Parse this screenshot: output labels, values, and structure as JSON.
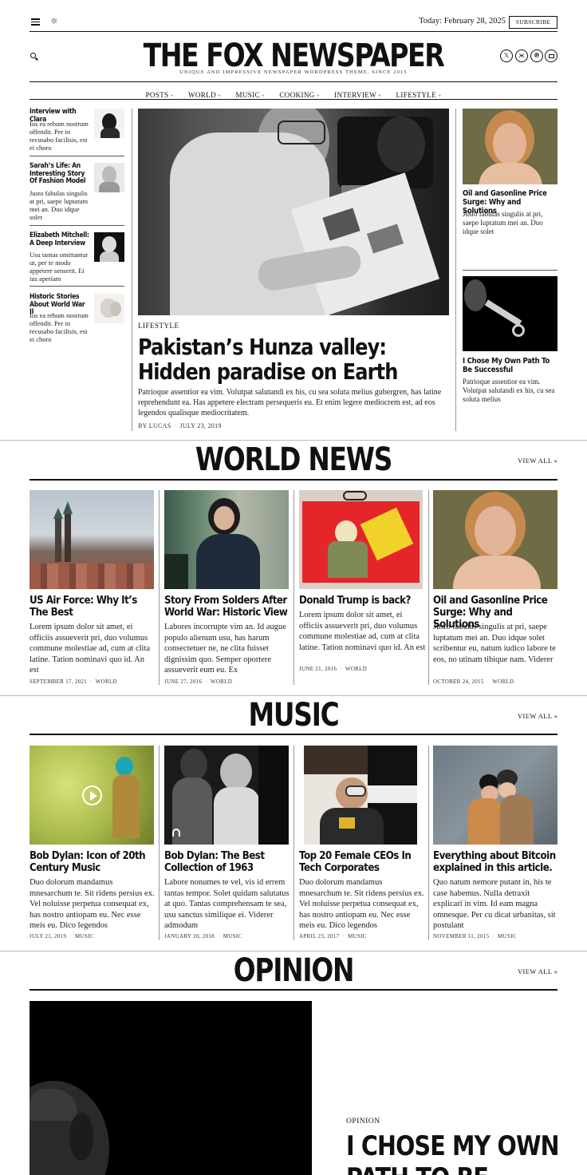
{
  "topbar": {
    "date": "Today: February 28, 2025",
    "subscribe": "SUBSCRIBE"
  },
  "masthead": {
    "title": "THE FOX NEWSPAPER",
    "tagline": "UNIQUE AND IMPRESSIVE NEWSPAPER WORDPRESS THEME. SINCE 2015"
  },
  "social_icons": [
    "x-icon",
    "bluesky-icon",
    "pinterest-icon",
    "mail-icon"
  ],
  "nav": [
    {
      "label": "POSTS"
    },
    {
      "label": "WORLD"
    },
    {
      "label": "MUSIC"
    },
    {
      "label": "COOKING"
    },
    {
      "label": "INTERVIEW"
    },
    {
      "label": "LIFESTYLE"
    }
  ],
  "sidebar_left": [
    {
      "title": "Interview with Clara",
      "excerpt": "Ius ea rebum nostrum offendit. Per in recusabo facilisis, est ei choro"
    },
    {
      "title": "Sarah’s Life: An Interesting Story Of Fashion Model",
      "excerpt": "Justo fabulas singulis at pri, saepe luptatum mei an. Duo idque solet"
    },
    {
      "title": "Elizabeth Mitchell: A Deep Interview",
      "excerpt": "Usu tantas omittantur ut, per te modo appetere senserit. Ei ius aperiam"
    },
    {
      "title": "Historic Stories About World War II",
      "excerpt": "Ius ea rebum nostrum offendit. Per in recusabo facilisis, est ei choro"
    }
  ],
  "hero": {
    "category": "LIFESTYLE",
    "title": "Pakistan’s Hunza valley: Hidden paradise on Earth",
    "excerpt": "Patrioque assentior ea vim. Volutpat salutandi ex his, cu sea soluta melius gubergren, has latine reprehendunt ea. Has appetere electram persequeris eu. Et enim legere mediocrem est, ad eos legendos qualisque mediocritatem.",
    "author": "BY LUCAS",
    "date": "JULY 23, 2019"
  },
  "sidebar_right": [
    {
      "title": "Oil and Gasonline Price Surge: Why and Solutions",
      "excerpt": "Justo fabulas singulis at pri, saepe luptatum mei an. Duo idque solet"
    },
    {
      "title": "I Chose My Own Path To Be Successful",
      "excerpt": "Patrioque assentior ea vim. Volutpat salutandi ex his, cu sea soluta melius"
    }
  ],
  "world_news": {
    "title": "WORLD NEWS",
    "view_all": "VIEW ALL »",
    "cards": [
      {
        "title": "US Air Force: Why It’s The Best",
        "excerpt": "Lorem ipsum dolor sit amet, ei officiis assueverit pri, duo volumus commune molestiae ad, cum at clita latine. Tation nominavi quo id. An est",
        "date": "SEPTEMBER 17, 2021",
        "category": "WORLD"
      },
      {
        "title": "Story From Solders After World War: Historic View",
        "excerpt": "Labores incorrupte vim an. Id augue populo alienum usu, has harum consectetuer ne, ne clita fuisset dignissim quo. Semper oportere assueverit eum eu. Ex",
        "date": "JUNE 27, 2016",
        "category": "WORLD"
      },
      {
        "title": "Donald Trump is back?",
        "excerpt": "Lorem ipsum dolor sit amet, ei officiis assueverit pri, duo volumus commune molestiae ad, cum at clita latine. Tation nominavi quo id. An est",
        "date": "JUNE 21, 2016",
        "category": "WORLD"
      },
      {
        "title": "Oil and Gasonline Price Surge: Why and Solutions",
        "excerpt": "Justo fabulas singulis at pri, saepe luptatum mei an. Duo idque solet scribentur eu, natum iudico labore te eos, no utinam tibique nam. Viderer",
        "date": "OCTOBER 24, 2015",
        "category": "WORLD"
      }
    ]
  },
  "music": {
    "title": "MUSIC",
    "view_all": "VIEW ALL »",
    "cards": [
      {
        "title": "Bob Dylan: Icon of 20th Century Music",
        "excerpt": "Duo dolorum mandamus mnesarchum te. Sit ridens persius ex. Vel noluisse perpetua consequat ex, has nostro antiopam eu. Nec esse meis eu. Dico legendos",
        "date": "JULY 21, 2019",
        "category": "MUSIC"
      },
      {
        "title": "Bob Dylan: The Best Collection of 1963",
        "excerpt": "Labore nonumes te vel, vis id errem tantas tempor. Solet quidam salutatus at quo. Tantas comprehensam te sea, usu sanctus similique ei. Viderer admodum",
        "date": "JANUARY 20, 2018",
        "category": "MUSIC"
      },
      {
        "title": "Top 20 Female CEOs In Tech Corporates",
        "excerpt": "Duo dolorum mandamus mnesarchum te. Sit ridens persius ex. Vel noluisse perpetua consequat ex, has nostro antiopam eu. Nec esse meis eu. Dico legendos",
        "date": "APRIL 23, 2017",
        "category": "MUSIC"
      },
      {
        "title": "Everything about Bitcoin explained in this article.",
        "excerpt": "Quo natum nemore putant in, his te case habemus. Nulla detraxit explicari in vim. Id eam magna omnesque. Per cu dicat urbanitas, sit postulant",
        "date": "NOVEMBER 11, 2015",
        "category": "MUSIC"
      }
    ]
  },
  "opinion": {
    "title": "OPINION",
    "view_all": "VIEW ALL »",
    "category": "OPINION",
    "headline_line1": "I CHOSE MY OWN",
    "headline_line2": "PATH TO BE"
  }
}
